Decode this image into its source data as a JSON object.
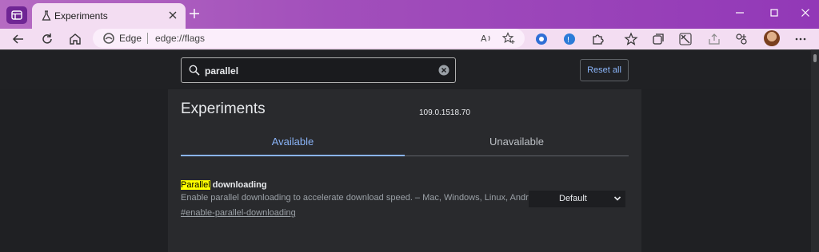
{
  "browser": {
    "tab": {
      "title": "Experiments"
    },
    "address_bar": {
      "site_label": "Edge",
      "url": "edge://flags"
    }
  },
  "flags_page": {
    "search": {
      "value": "parallel"
    },
    "reset_all_label": "Reset all",
    "title": "Experiments",
    "version": "109.0.1518.70",
    "tabs": [
      {
        "label": "Available",
        "active": true
      },
      {
        "label": "Unavailable",
        "active": false
      }
    ],
    "flags": [
      {
        "name_highlight": "Parallel",
        "name_rest": " downloading",
        "description": "Enable parallel downloading to accelerate download speed. – Mac, Windows, Linux, Android",
        "link": "#enable-parallel-downloading",
        "selected_option": "Default"
      }
    ]
  },
  "colors": {
    "titlebar_accent": "#9238b7",
    "tab_active": "#f3ddf2",
    "link_blue": "#8ab4f8",
    "highlight": "#ffff00",
    "page_bg": "#202124"
  },
  "icons": [
    "workspaces-icon",
    "flask-icon",
    "close-icon",
    "plus-icon",
    "minimize-icon",
    "maximize-icon",
    "close-window-icon",
    "back-icon",
    "refresh-icon",
    "home-icon",
    "edge-logo-icon",
    "read-aloud-icon",
    "add-favorite-icon",
    "extension-icon",
    "favorites-icon",
    "collections-icon",
    "math-solver-icon",
    "browser-essentials-icon",
    "share-icon",
    "copilot-icon",
    "more-icon",
    "search-icon",
    "clear-icon",
    "chevron-down-icon"
  ]
}
